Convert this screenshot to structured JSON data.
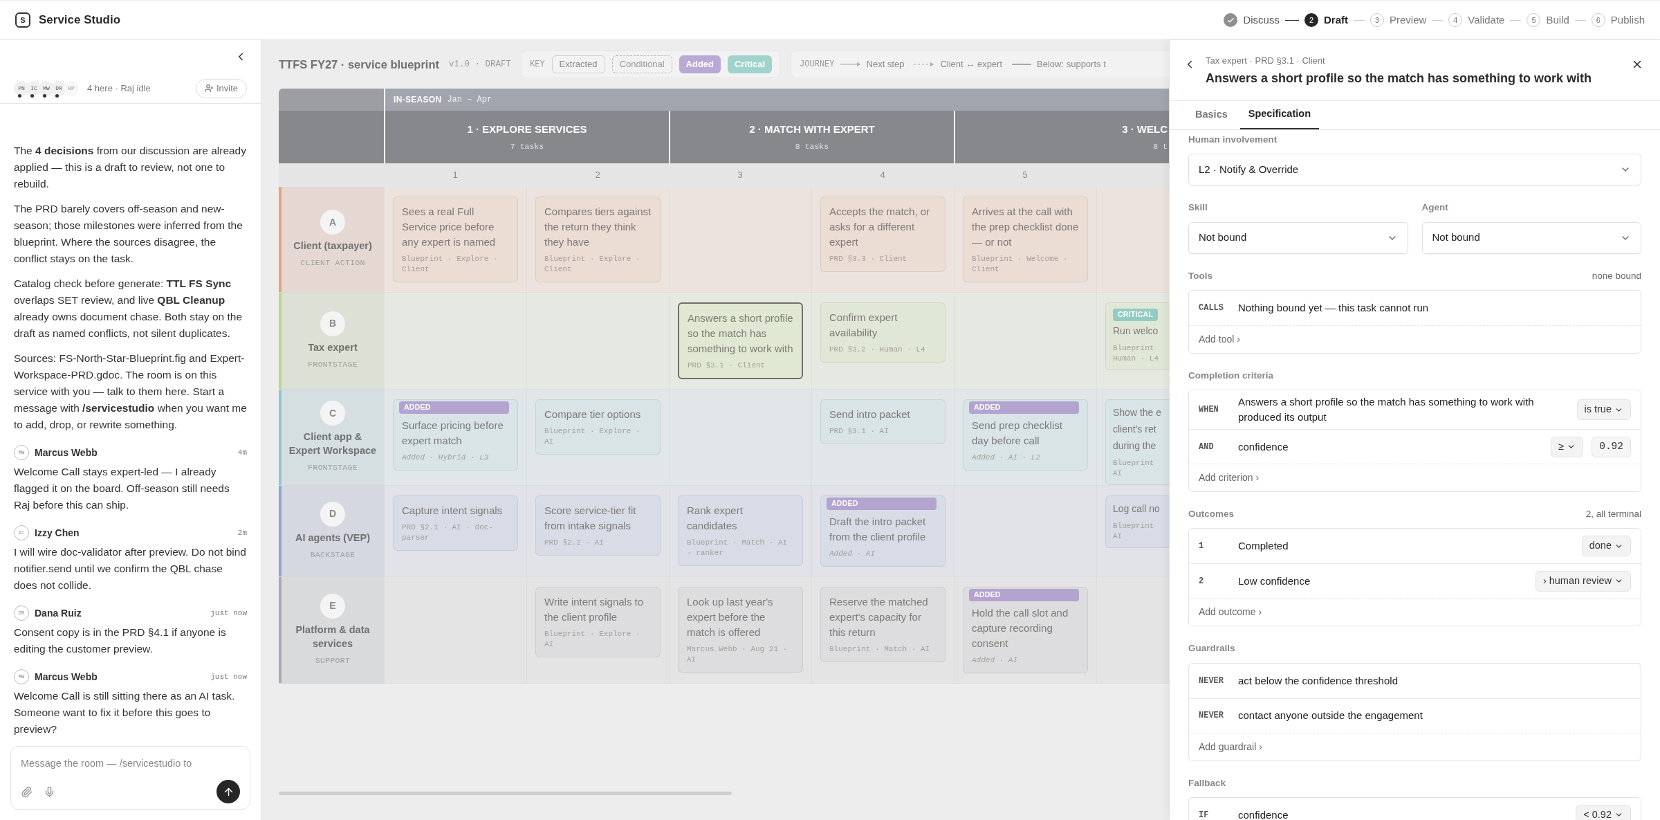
{
  "app": {
    "logo": "S",
    "title": "Service Studio"
  },
  "steps": [
    {
      "label": "Discuss",
      "completed": true,
      "selected": false
    },
    {
      "number": "2",
      "label": "Draft",
      "completed": false,
      "selected": true
    },
    {
      "number": "3",
      "label": "Preview",
      "completed": false,
      "selected": false
    },
    {
      "number": "4",
      "label": "Validate",
      "completed": false,
      "selected": false
    },
    {
      "number": "5",
      "label": "Build",
      "completed": false,
      "selected": false
    },
    {
      "number": "6",
      "label": "Publish",
      "completed": false,
      "selected": false
    }
  ],
  "room": {
    "presence": {
      "avatars": [
        {
          "initials": "PN",
          "idle": false
        },
        {
          "initials": "IC",
          "idle": false
        },
        {
          "initials": "MW",
          "idle": false
        },
        {
          "initials": "DR",
          "idle": false
        },
        {
          "initials": "RP",
          "idle": true
        }
      ],
      "summary": "4 here · Raj idle",
      "invite": "Invite"
    },
    "feed": [
      {
        "kind": "note",
        "text": "The **4 decisions** from our discussion are already applied — this is a draft to review, not one to rebuild."
      },
      {
        "kind": "note",
        "text": "The PRD barely covers off-season and new-season; those milestones were inferred from the blueprint. Where the sources disagree, the conflict stays on the task."
      },
      {
        "kind": "note",
        "text": "Catalog check before generate: **TTL FS Sync** overlaps SET review, and live **QBL Cleanup** already owns document chase. Both stay on the draft as named conflicts, not silent duplicates."
      },
      {
        "kind": "note",
        "text": "Sources: FS-North-Star-Blueprint.fig and Expert-Workspace-PRD.gdoc. The room is on this service with you — talk to them here. Start a message with **/servicestudio** when you want me to add, drop, or rewrite something."
      },
      {
        "kind": "message",
        "initials": "MW",
        "author": "Marcus Webb",
        "time": "4m",
        "text": "Welcome Call stays expert-led — I already flagged it on the board. Off-season still needs Raj before this can ship."
      },
      {
        "kind": "message",
        "initials": "IC",
        "author": "Izzy Chen",
        "time": "2m",
        "text": "I will wire doc-validator after preview. Do not bind notifier.send until we confirm the QBL chase does not collide."
      },
      {
        "kind": "message",
        "initials": "DR",
        "author": "Dana Ruiz",
        "time": "just now",
        "text": "Consent copy is in the PRD §4.1 if anyone is editing the customer preview."
      },
      {
        "kind": "message",
        "initials": "MW",
        "author": "Marcus Webb",
        "time": "just now",
        "text": "Welcome Call is still sitting there as an AI task. Someone want to fix it before this goes to preview?"
      }
    ],
    "composer": {
      "placeholder": "Message the room — /servicestudio to"
    }
  },
  "blueprint": {
    "title": "TTFS FY27 · service blueprint",
    "version": "v1.0 · DRAFT",
    "key": {
      "label": "KEY",
      "items": [
        {
          "label": "Extracted",
          "kind": "extracted"
        },
        {
          "label": "Conditional",
          "kind": "conditional"
        },
        {
          "label": "Added",
          "kind": "added"
        },
        {
          "label": "Critical",
          "kind": "critical"
        }
      ]
    },
    "journey": {
      "label": "JOURNEY",
      "items": [
        {
          "label": "Next step",
          "kind": "solid_arrow"
        },
        {
          "label": "Client ↔ expert",
          "kind": "dashed_arrow"
        },
        {
          "label": "Below: supports t",
          "kind": "line"
        }
      ]
    },
    "season": {
      "name": "IN-SEASON",
      "months": "Jan – Apr"
    },
    "phases": [
      {
        "title": "1 · EXPLORE SERVICES",
        "tasks": "7 tasks",
        "kind": "full"
      },
      {
        "title": "2 · MATCH WITH EXPERT",
        "tasks": "8 tasks",
        "kind": "full"
      },
      {
        "title": "3 · WELC",
        "tasks": "8 t",
        "kind": "cut"
      }
    ],
    "columns": [
      "1",
      "2",
      "3",
      "4",
      "5"
    ],
    "lanes": [
      {
        "letter": "A",
        "name": "Client (taxpayer)",
        "layer": "CLIENT ACTION",
        "color": "#e8a27e",
        "cells": [
          {
            "kind": "card",
            "text": "Sees a real Full Service price before any expert is named",
            "meta": "Blueprint · Explore · Client",
            "selected": false
          },
          {
            "kind": "card",
            "text": "Compares tiers against the return they think they have",
            "meta": "Blueprint · Explore · Client",
            "selected": false
          },
          {
            "kind": "empty"
          },
          {
            "kind": "card",
            "text": "Accepts the match, or asks for a different expert",
            "meta": "PRD §3.3 · Client",
            "selected": false
          },
          {
            "kind": "card",
            "text": "Arrives at the call with the prep checklist done — or not",
            "meta": "Blueprint · Welcome · Client",
            "selected": false
          },
          {
            "kind": "empty"
          }
        ]
      },
      {
        "letter": "B",
        "name": "Tax expert",
        "layer": "FRONTSTAGE",
        "color": "#bcd68e",
        "cells": [
          {
            "kind": "empty"
          },
          {
            "kind": "empty"
          },
          {
            "kind": "card",
            "text": "Answers a short profile so the match has something to work with",
            "meta": "PRD §3.1 · Client",
            "selected": true
          },
          {
            "kind": "card",
            "text": "Confirm expert availability",
            "meta": "PRD §3.2 · Human · L4",
            "selected": false
          },
          {
            "kind": "empty"
          },
          {
            "kind": "cut_card",
            "badge": {
              "label": "CRITICAL",
              "kind": "critical"
            },
            "lines": [
              "Run welco"
            ],
            "meta_lines": [
              "Blueprint",
              "Human · L4"
            ],
            "selected": false
          }
        ]
      },
      {
        "letter": "C",
        "name": "Client app & Expert Workspace",
        "layer": "FRONTSTAGE",
        "color": "#92c6d2",
        "cells": [
          {
            "kind": "card",
            "badge": {
              "label": "ADDED",
              "kind": "added"
            },
            "text": "Surface pricing before expert match",
            "meta": "Added · Hybrid · L3",
            "selected": false
          },
          {
            "kind": "card",
            "text": "Compare tier options",
            "meta": "Blueprint · Explore · AI",
            "selected": false
          },
          {
            "kind": "empty"
          },
          {
            "kind": "card",
            "text": "Send intro packet",
            "meta": "PRD §3.1 · AI",
            "selected": false
          },
          {
            "kind": "card",
            "badge": {
              "label": "ADDED",
              "kind": "added"
            },
            "text": "Send prep checklist day before call",
            "meta": "Added · AI · L2",
            "selected": false
          },
          {
            "kind": "cut_card",
            "lines": [
              "Show the e",
              "client's ret",
              "during the"
            ],
            "meta_lines": [
              "Blueprint",
              "AI"
            ],
            "selected": false
          }
        ]
      },
      {
        "letter": "D",
        "name": "AI agents (VEP)",
        "layer": "BACKSTAGE",
        "color": "#8ea4d6",
        "cells": [
          {
            "kind": "card",
            "text": "Capture intent signals",
            "meta": "PRD §2.1 · AI · doc-parser",
            "selected": false
          },
          {
            "kind": "card",
            "text": "Score service-tier fit from intake signals",
            "meta": "PRD §2.2 · AI",
            "selected": false
          },
          {
            "kind": "card",
            "text": "Rank expert candidates",
            "meta": "Blueprint · Match · AI · ranker",
            "selected": false
          },
          {
            "kind": "card",
            "badge": {
              "label": "ADDED",
              "kind": "added"
            },
            "text": "Draft the intro packet from the client profile",
            "meta": "Added · AI",
            "selected": false
          },
          {
            "kind": "empty"
          },
          {
            "kind": "cut_card",
            "lines": [
              "Log call no"
            ],
            "meta_lines": [
              "Blueprint",
              "AI"
            ],
            "selected": false
          }
        ]
      },
      {
        "letter": "E",
        "name": "Platform & data services",
        "layer": "SUPPORT",
        "color": "#a9aab2",
        "cells": [
          {
            "kind": "empty"
          },
          {
            "kind": "card",
            "text": "Write intent signals to the client profile",
            "meta": "Blueprint · Explore · AI",
            "selected": false
          },
          {
            "kind": "card",
            "text": "Look up last year's expert before the match is offered",
            "meta": "Marcus Webb · Aug 21 · AI",
            "selected": false
          },
          {
            "kind": "card",
            "text": "Reserve the matched expert's capacity for this return",
            "meta": "Blueprint · Match · AI",
            "selected": false
          },
          {
            "kind": "card",
            "badge": {
              "label": "ADDED",
              "kind": "added"
            },
            "text": "Hold the call slot and capture recording consent",
            "meta": "Added · AI",
            "selected": false
          },
          {
            "kind": "empty"
          }
        ]
      }
    ]
  },
  "detail": {
    "breadcrumb": "Tax expert · PRD §3.1 · Client",
    "title": "Answers a short profile so the match has something to work with",
    "tabs": [
      {
        "label": "Basics",
        "selected": false
      },
      {
        "label": "Specification",
        "selected": true
      }
    ],
    "human_involvement": {
      "label": "Human involvement",
      "value": "L2 · Notify & Override"
    },
    "skill": {
      "label": "Skill",
      "value": "Not bound"
    },
    "agent": {
      "label": "Agent",
      "value": "Not bound"
    },
    "sections": [
      {
        "label": "Tools",
        "summary": "none bound",
        "rows": [
          {
            "keyword": "CALLS",
            "text": "Nothing bound yet — this task cannot run"
          }
        ],
        "add": "Add tool ›"
      },
      {
        "label": "Completion criteria",
        "rows": [
          {
            "keyword": "WHEN",
            "text": "Answers a short profile so the match has something to work with produced its output",
            "operator": "is true"
          },
          {
            "keyword": "AND",
            "text": "confidence",
            "operator": "≥",
            "value": "0.92"
          }
        ],
        "add": "Add criterion ›"
      },
      {
        "label": "Outcomes",
        "summary": "2, all terminal",
        "rows": [
          {
            "keyword": "1",
            "text": "Completed",
            "operator": "done"
          },
          {
            "keyword": "2",
            "text": "Low confidence",
            "operator": "› human review"
          }
        ],
        "add": "Add outcome ›"
      },
      {
        "label": "Guardrails",
        "rows": [
          {
            "keyword": "NEVER",
            "text": "act below the confidence threshold"
          },
          {
            "keyword": "NEVER",
            "text": "contact anyone outside the engagement"
          }
        ],
        "add": "Add guardrail ›"
      },
      {
        "label": "Fallback",
        "rows": [
          {
            "keyword": "IF",
            "text": "confidence",
            "operator": "< 0.92"
          }
        ]
      }
    ]
  }
}
